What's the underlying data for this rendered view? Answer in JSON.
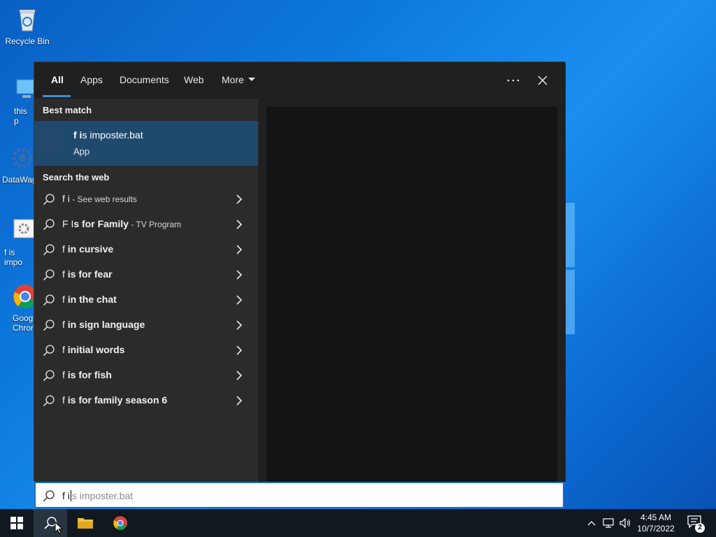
{
  "desktop": {
    "icons": [
      {
        "name": "recycle-bin",
        "label": "Recycle Bin"
      },
      {
        "name": "this-pc",
        "label": "this p"
      },
      {
        "name": "datawag",
        "label": "DataWag"
      },
      {
        "name": "f-is-imposter",
        "label": "f is impo"
      },
      {
        "name": "google-chrome",
        "label": "Goog Chron"
      }
    ]
  },
  "tabs": {
    "items": [
      "All",
      "Apps",
      "Documents",
      "Web",
      "More"
    ],
    "active": "All"
  },
  "best_match": {
    "heading": "Best match",
    "title_bold": "f i",
    "title_rest": "s imposter.bat",
    "subtitle": "App"
  },
  "web_search": {
    "heading": "Search the web",
    "results": [
      {
        "prefix": "f i",
        "bold": "",
        "hint": " - See web results"
      },
      {
        "prefix": "F I",
        "bold": "s for Family",
        "hint": " - TV Program"
      },
      {
        "prefix": "f ",
        "bold": "in cursive",
        "hint": ""
      },
      {
        "prefix": "f ",
        "bold": "is for fear",
        "hint": ""
      },
      {
        "prefix": "f ",
        "bold": "in the chat",
        "hint": ""
      },
      {
        "prefix": "f ",
        "bold": "in sign language",
        "hint": ""
      },
      {
        "prefix": "f ",
        "bold": "initial words",
        "hint": ""
      },
      {
        "prefix": "f ",
        "bold": "is for fish",
        "hint": ""
      },
      {
        "prefix": "f ",
        "bold": "is for family season 6",
        "hint": ""
      }
    ]
  },
  "searchbox": {
    "typed_before": "f i",
    "ghost": "s imposter.bat"
  },
  "taskbar": {
    "time": "4:45 AM",
    "date": "10/7/2022",
    "notification_count": "2",
    "pinned": [
      "start-icon",
      "search-icon",
      "file-explorer-icon",
      "chrome-icon"
    ]
  },
  "colors": {
    "accent": "#3f8fd6",
    "best_match_bg": "#1f4a6e",
    "panel_bg": "#2b2b2b"
  }
}
